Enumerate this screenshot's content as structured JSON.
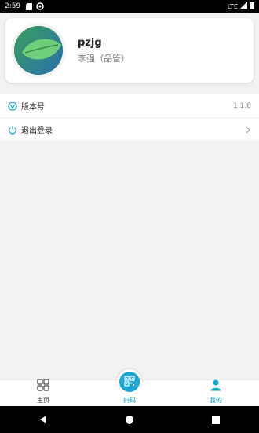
{
  "status_bar": {
    "time": "2:59",
    "network": "LTE"
  },
  "profile": {
    "username": "pzjg",
    "role": "李强（品管）"
  },
  "menu": {
    "items": [
      {
        "label": "版本号",
        "value": "1.1.8",
        "icon": "version-v-icon"
      },
      {
        "label": "退出登录",
        "icon": "power-icon",
        "chevron": true
      }
    ]
  },
  "bottom_nav": {
    "tabs": [
      {
        "label": "主页",
        "icon": "grid-icon",
        "active": false
      },
      {
        "label": "扫码",
        "icon": "qr-code-icon",
        "active": false
      },
      {
        "label": "我的",
        "icon": "person-icon",
        "active": true
      }
    ],
    "active_color": "#1aa5c5"
  },
  "colors": {
    "accent": "#1aa5d5",
    "page_bg": "#f2f2f4"
  }
}
